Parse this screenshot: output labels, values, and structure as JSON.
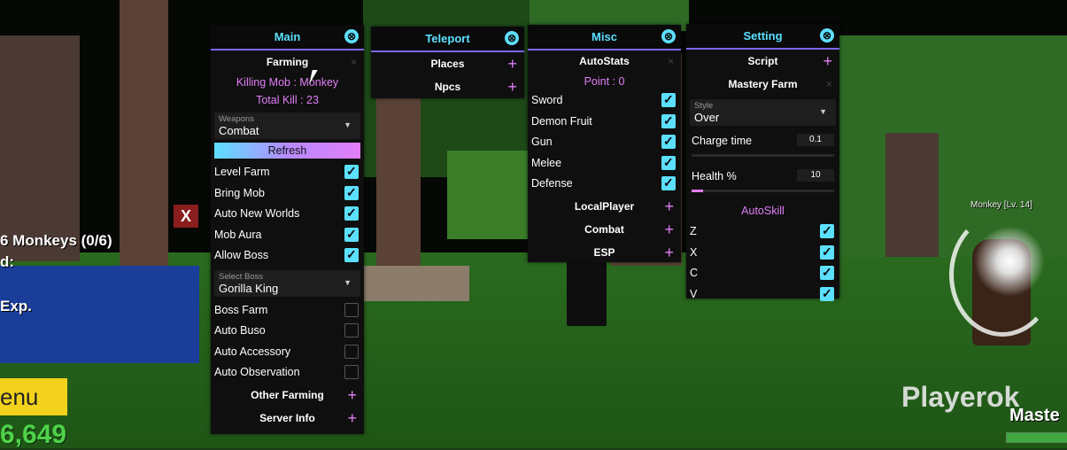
{
  "hud": {
    "quest": "6 Monkeys (0/6)",
    "reward_label": "d:",
    "exp": "Exp.",
    "menu": "enu",
    "money": "6,649",
    "close": "X"
  },
  "watermark": "Playerok",
  "mastery": "Maste",
  "npc_label": "Monkey [Lv. 14]",
  "main": {
    "title": "Main",
    "farming": "Farming",
    "killing_mob": "Killing Mob : Monkey",
    "total_kill": "Total Kill : 23",
    "weapons_label": "Weapons",
    "weapons_value": "Combat",
    "refresh": "Refresh",
    "toggles": [
      {
        "label": "Level Farm",
        "on": true
      },
      {
        "label": "Bring Mob",
        "on": true
      },
      {
        "label": "Auto New Worlds",
        "on": true
      },
      {
        "label": "Mob Aura",
        "on": true
      },
      {
        "label": "Allow Boss",
        "on": true
      }
    ],
    "boss_label": "Select Boss",
    "boss_value": "Gorilla King",
    "toggles2": [
      {
        "label": "Boss Farm",
        "on": false
      },
      {
        "label": "Auto Buso",
        "on": false
      },
      {
        "label": "Auto Accessory",
        "on": false
      },
      {
        "label": "Auto Observation",
        "on": false
      }
    ],
    "other_farming": "Other Farming",
    "server_info": "Server Info"
  },
  "teleport": {
    "title": "Teleport",
    "places": "Places",
    "npcs": "Npcs"
  },
  "misc": {
    "title": "Misc",
    "autostats": "AutoStats",
    "point": "Point : 0",
    "toggles": [
      {
        "label": "Sword",
        "on": true
      },
      {
        "label": "Demon Fruit",
        "on": true
      },
      {
        "label": "Gun",
        "on": true
      },
      {
        "label": "Melee",
        "on": true
      },
      {
        "label": "Defense",
        "on": true
      }
    ],
    "localplayer": "LocalPlayer",
    "combat": "Combat",
    "esp": "ESP"
  },
  "setting": {
    "title": "Setting",
    "script": "Script",
    "mastery_farm": "Mastery Farm",
    "style_label": "Style",
    "style_value": "Over",
    "charge_time": "Charge time",
    "charge_value": "0.1",
    "health": "Health %",
    "health_value": "10",
    "autoskill": "AutoSkill",
    "skills": [
      {
        "label": "Z",
        "on": true
      },
      {
        "label": "X",
        "on": true
      },
      {
        "label": "C",
        "on": true
      },
      {
        "label": "V",
        "on": true
      }
    ]
  },
  "icons": {
    "close": "⊗",
    "plus": "+",
    "x_small": "×",
    "arrow": "▼"
  }
}
